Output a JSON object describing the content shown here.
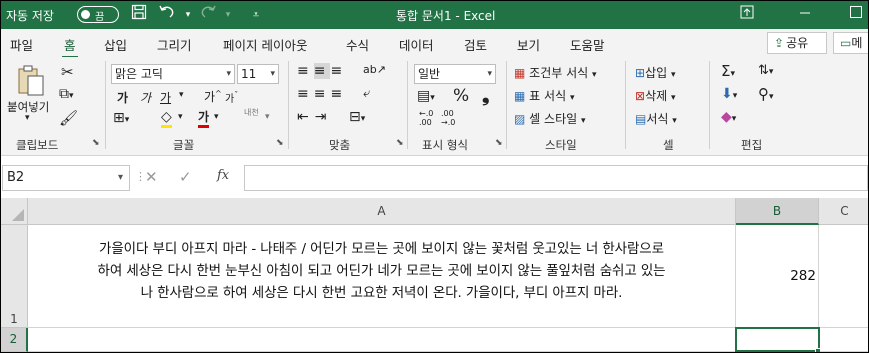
{
  "titlebar": {
    "autosave_label": "자동 저장",
    "autosave_state": "끔",
    "document_title": "통합 문서1  -  Excel",
    "icons": [
      "save-icon",
      "undo-icon",
      "redo-icon",
      "customize-icon",
      "restore-icon",
      "minimize-icon",
      "maximize-icon"
    ]
  },
  "menu": {
    "tabs": [
      "파일",
      "홈",
      "삽입",
      "그리기",
      "페이지 레이아웃",
      "수식",
      "데이터",
      "검토",
      "보기",
      "도움말"
    ],
    "active_tab": "홈",
    "share_label": "공유",
    "memo_label": "메"
  },
  "ribbon": {
    "clipboard": {
      "paste_label": "붙여넣기",
      "group_label": "클립보드"
    },
    "font": {
      "font_name": "맑은 고딕",
      "font_size": "11",
      "bold": "가",
      "italic": "가",
      "underline": "가",
      "grow": "가",
      "shrink": "가",
      "font_color_glyph": "가",
      "phonetic": "내천",
      "group_label": "글꼴"
    },
    "alignment": {
      "group_label": "맞춤"
    },
    "number": {
      "format": "일반",
      "percent": "%",
      "comma": "❟",
      "inc_decimal": "←.0\n.00",
      "dec_decimal": ".00\n→.0",
      "group_label": "표시 형식"
    },
    "styles": {
      "conditional": "조건부 서식",
      "table": "표 서식",
      "cell_style": "셀 스타일",
      "group_label": "스타일"
    },
    "cells": {
      "insert": "삽입",
      "delete": "삭제",
      "format": "서식",
      "group_label": "셀"
    },
    "editing": {
      "group_label": "편집"
    }
  },
  "formula_bar": {
    "name_box": "B2",
    "fx": "fx",
    "value": ""
  },
  "grid": {
    "columns": [
      "A",
      "B",
      "C"
    ],
    "rows": [
      "1",
      "2"
    ],
    "A1_lines": [
      "가을이다 부디 아프지 마라 - 나태주 / 어딘가 모르는 곳에 보이지 않는 꽃처럼 웃고있는 너 한사람으로",
      "하여 세상은 다시 한번 눈부신 아침이 되고 어딘가 네가 모르는 곳에 보이지 않는 풀잎처럼 숨쉬고 있는",
      "나 한사람으로 하여 세상은 다시 한번 고요한 저녁이 온다. 가을이다, 부디 아프지 마라."
    ],
    "B1": "282",
    "selected_cell": "B2"
  },
  "colors": {
    "accent": "#217346",
    "ribbon_bg": "#f3f3f3"
  }
}
